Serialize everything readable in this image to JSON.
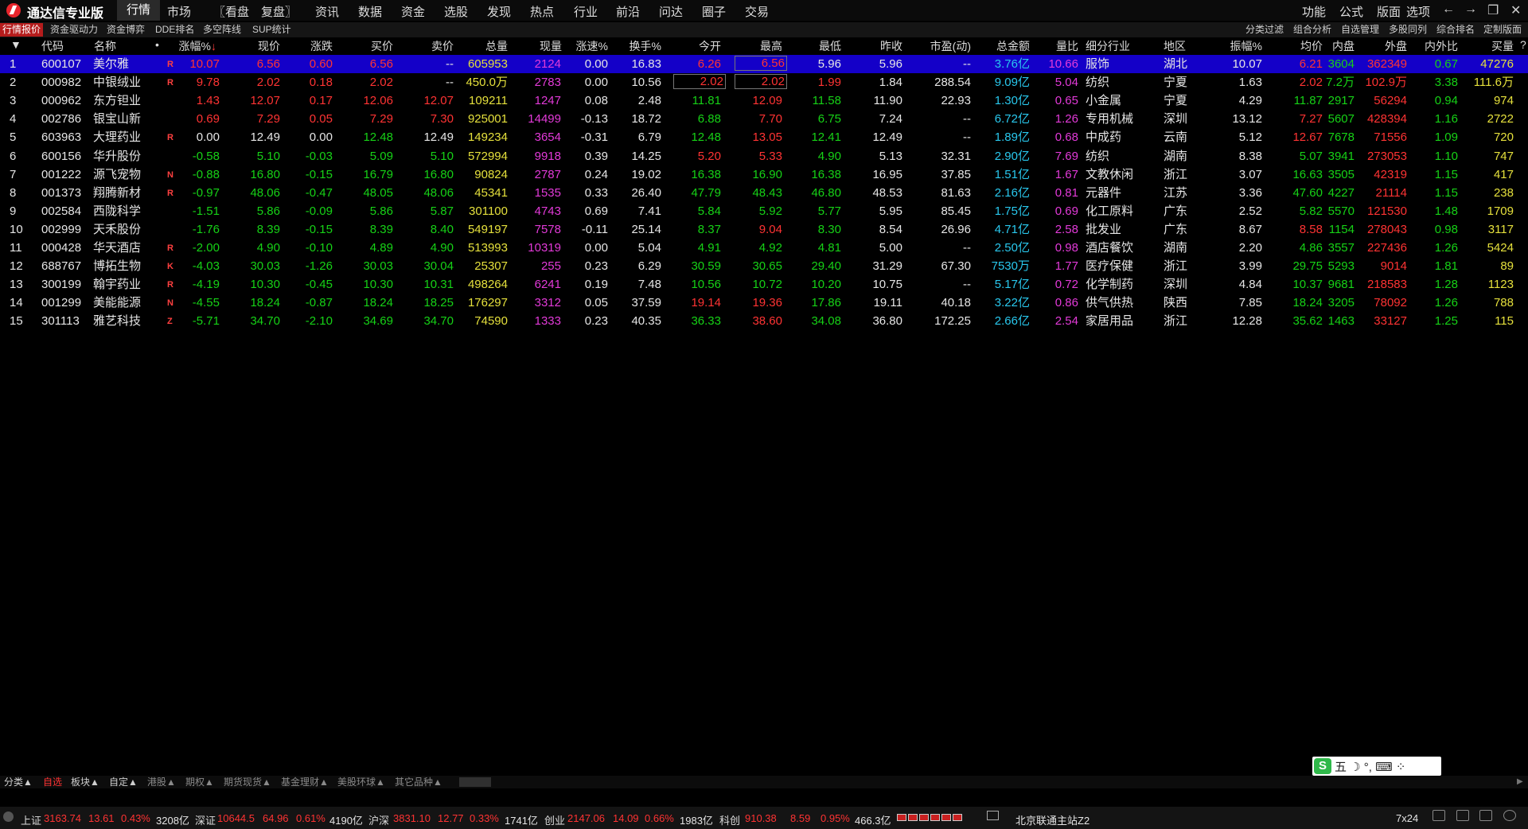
{
  "app": {
    "title": "通达信专业版"
  },
  "menu": [
    "行情",
    "市场",
    "〖看盘",
    "复盘〗",
    "资讯",
    "数据",
    "资金",
    "选股",
    "发现",
    "热点",
    "行业",
    "前沿",
    "问达",
    "圈子",
    "交易"
  ],
  "right_menu": [
    "功能",
    "公式",
    "版面",
    "选项"
  ],
  "window_controls": {
    "back": "←",
    "forward": "→",
    "restore": "❐",
    "minimize": "—",
    "close": "✕"
  },
  "tabs": [
    "行情报价",
    "资金驱动力",
    "资金博弈",
    "DDE排名",
    "多空阵线",
    "SUP统计"
  ],
  "right_tabs": [
    "分类过滤",
    "组合分析",
    "自选管理",
    "多股同列",
    "综合排名",
    "定制版面"
  ],
  "table": {
    "headers": {
      "idx": "▼",
      "code": "代码",
      "name": "名称",
      "dot": "•",
      "pct": "涨幅%",
      "sort": "↓",
      "price": "现价",
      "chg": "涨跌",
      "bid": "买价",
      "ask": "卖价",
      "vol": "总量",
      "cur": "现量",
      "speed": "涨速%",
      "turn": "换手%",
      "open": "今开",
      "high": "最高",
      "low": "最低",
      "prev": "昨收",
      "pe": "市盈(动)",
      "amount": "总金额",
      "vratio": "量比",
      "industry": "细分行业",
      "region": "地区",
      "amp": "振幅%",
      "avg": "均价",
      "inner": "内盘",
      "outer": "外盘",
      "io": "内外比",
      "bidvol": "买量",
      "q": "?"
    },
    "rows": [
      {
        "n": "1",
        "code": "600107",
        "name": "美尔雅",
        "tag": "R",
        "pct": "10.07",
        "price": "6.56",
        "chg": "0.60",
        "bid": "6.56",
        "ask": "--",
        "vol": "605953",
        "cur": "2124",
        "speed": "0.00",
        "turn": "16.83",
        "open": "6.26",
        "high": "6.56",
        "low": "5.96",
        "prev": "5.96",
        "pe": "--",
        "amount": "3.76亿",
        "vratio": "10.66",
        "industry": "服饰",
        "region": "湖北",
        "amp": "10.07",
        "avg": "6.21",
        "inner": "3604",
        "outer": "362349",
        "io": "0.67",
        "bidvol": "47276",
        "c": {
          "pct": "red",
          "price": "red",
          "chg": "red",
          "bid": "red",
          "ask": "white",
          "open": "red",
          "high": "red",
          "low": "white",
          "avg": "red"
        }
      },
      {
        "n": "2",
        "code": "000982",
        "name": "中银绒业",
        "tag": "R",
        "pct": "9.78",
        "price": "2.02",
        "chg": "0.18",
        "bid": "2.02",
        "ask": "--",
        "vol": "450.0万",
        "cur": "2783",
        "speed": "0.00",
        "turn": "10.56",
        "open": "2.02",
        "high": "2.02",
        "low": "1.99",
        "prev": "1.84",
        "pe": "288.54",
        "amount": "9.09亿",
        "vratio": "5.04",
        "industry": "纺织",
        "region": "宁夏",
        "amp": "1.63",
        "avg": "2.02",
        "inner": "7.2万",
        "outer": "102.9万",
        "io": "3.38",
        "bidvol": "111.6万",
        "c": {
          "pct": "red",
          "price": "red",
          "chg": "red",
          "bid": "red",
          "ask": "white",
          "open": "red",
          "high": "red",
          "low": "red",
          "avg": "red"
        }
      },
      {
        "n": "3",
        "code": "000962",
        "name": "东方钽业",
        "tag": "",
        "pct": "1.43",
        "price": "12.07",
        "chg": "0.17",
        "bid": "12.06",
        "ask": "12.07",
        "vol": "109211",
        "cur": "1247",
        "speed": "0.08",
        "turn": "2.48",
        "open": "11.81",
        "high": "12.09",
        "low": "11.58",
        "prev": "11.90",
        "pe": "22.93",
        "amount": "1.30亿",
        "vratio": "0.65",
        "industry": "小金属",
        "region": "宁夏",
        "amp": "4.29",
        "avg": "11.87",
        "inner": "2917",
        "outer": "56294",
        "io": "0.94",
        "bidvol": "974",
        "c": {
          "pct": "red",
          "price": "red",
          "chg": "red",
          "bid": "red",
          "ask": "red",
          "open": "green",
          "high": "red",
          "low": "green",
          "avg": "green"
        }
      },
      {
        "n": "4",
        "code": "002786",
        "name": "银宝山新",
        "tag": "",
        "pct": "0.69",
        "price": "7.29",
        "chg": "0.05",
        "bid": "7.29",
        "ask": "7.30",
        "vol": "925001",
        "cur": "14499",
        "speed": "-0.13",
        "turn": "18.72",
        "open": "6.88",
        "high": "7.70",
        "low": "6.75",
        "prev": "7.24",
        "pe": "--",
        "amount": "6.72亿",
        "vratio": "1.26",
        "industry": "专用机械",
        "region": "深圳",
        "amp": "13.12",
        "avg": "7.27",
        "inner": "5607",
        "outer": "428394",
        "io": "1.16",
        "bidvol": "2722",
        "c": {
          "pct": "red",
          "price": "red",
          "chg": "red",
          "bid": "red",
          "ask": "red",
          "open": "green",
          "high": "red",
          "low": "green",
          "avg": "red"
        }
      },
      {
        "n": "5",
        "code": "603963",
        "name": "大理药业",
        "tag": "R",
        "pct": "0.00",
        "price": "12.49",
        "chg": "0.00",
        "bid": "12.48",
        "ask": "12.49",
        "vol": "149234",
        "cur": "3654",
        "speed": "-0.31",
        "turn": "6.79",
        "open": "12.48",
        "high": "13.05",
        "low": "12.41",
        "prev": "12.49",
        "pe": "--",
        "amount": "1.89亿",
        "vratio": "0.68",
        "industry": "中成药",
        "region": "云南",
        "amp": "5.12",
        "avg": "12.67",
        "inner": "7678",
        "outer": "71556",
        "io": "1.09",
        "bidvol": "720",
        "c": {
          "pct": "white",
          "price": "white",
          "chg": "white",
          "bid": "green",
          "ask": "white",
          "open": "green",
          "high": "red",
          "low": "green",
          "avg": "red"
        }
      },
      {
        "n": "6",
        "code": "600156",
        "name": "华升股份",
        "tag": "",
        "pct": "-0.58",
        "price": "5.10",
        "chg": "-0.03",
        "bid": "5.09",
        "ask": "5.10",
        "vol": "572994",
        "cur": "9918",
        "speed": "0.39",
        "turn": "14.25",
        "open": "5.20",
        "high": "5.33",
        "low": "4.90",
        "prev": "5.13",
        "pe": "32.31",
        "amount": "2.90亿",
        "vratio": "7.69",
        "industry": "纺织",
        "region": "湖南",
        "amp": "8.38",
        "avg": "5.07",
        "inner": "3941",
        "outer": "273053",
        "io": "1.10",
        "bidvol": "747",
        "c": {
          "pct": "green",
          "price": "green",
          "chg": "green",
          "bid": "green",
          "ask": "green",
          "open": "red",
          "high": "red",
          "low": "green",
          "avg": "green"
        }
      },
      {
        "n": "7",
        "code": "001222",
        "name": "源飞宠物",
        "tag": "N",
        "pct": "-0.88",
        "price": "16.80",
        "chg": "-0.15",
        "bid": "16.79",
        "ask": "16.80",
        "vol": "90824",
        "cur": "2787",
        "speed": "0.24",
        "turn": "19.02",
        "open": "16.38",
        "high": "16.90",
        "low": "16.38",
        "prev": "16.95",
        "pe": "37.85",
        "amount": "1.51亿",
        "vratio": "1.67",
        "industry": "文教休闲",
        "region": "浙江",
        "amp": "3.07",
        "avg": "16.63",
        "inner": "3505",
        "outer": "42319",
        "io": "1.15",
        "bidvol": "417",
        "c": {
          "pct": "green",
          "price": "green",
          "chg": "green",
          "bid": "green",
          "ask": "green",
          "open": "green",
          "high": "green",
          "low": "green",
          "avg": "green"
        }
      },
      {
        "n": "8",
        "code": "001373",
        "name": "翔腾新材",
        "tag": "R",
        "pct": "-0.97",
        "price": "48.06",
        "chg": "-0.47",
        "bid": "48.05",
        "ask": "48.06",
        "vol": "45341",
        "cur": "1535",
        "speed": "0.33",
        "turn": "26.40",
        "open": "47.79",
        "high": "48.43",
        "low": "46.80",
        "prev": "48.53",
        "pe": "81.63",
        "amount": "2.16亿",
        "vratio": "0.81",
        "industry": "元器件",
        "region": "江苏",
        "amp": "3.36",
        "avg": "47.60",
        "inner": "4227",
        "outer": "21114",
        "io": "1.15",
        "bidvol": "238",
        "c": {
          "pct": "green",
          "price": "green",
          "chg": "green",
          "bid": "green",
          "ask": "green",
          "open": "green",
          "high": "green",
          "low": "green",
          "avg": "green"
        }
      },
      {
        "n": "9",
        "code": "002584",
        "name": "西陇科学",
        "tag": "",
        "pct": "-1.51",
        "price": "5.86",
        "chg": "-0.09",
        "bid": "5.86",
        "ask": "5.87",
        "vol": "301100",
        "cur": "4743",
        "speed": "0.69",
        "turn": "7.41",
        "open": "5.84",
        "high": "5.92",
        "low": "5.77",
        "prev": "5.95",
        "pe": "85.45",
        "amount": "1.75亿",
        "vratio": "0.69",
        "industry": "化工原料",
        "region": "广东",
        "amp": "2.52",
        "avg": "5.82",
        "inner": "5570",
        "outer": "121530",
        "io": "1.48",
        "bidvol": "1709",
        "c": {
          "pct": "green",
          "price": "green",
          "chg": "green",
          "bid": "green",
          "ask": "green",
          "open": "green",
          "high": "green",
          "low": "green",
          "avg": "green"
        }
      },
      {
        "n": "10",
        "code": "002999",
        "name": "天禾股份",
        "tag": "",
        "pct": "-1.76",
        "price": "8.39",
        "chg": "-0.15",
        "bid": "8.39",
        "ask": "8.40",
        "vol": "549197",
        "cur": "7578",
        "speed": "-0.11",
        "turn": "25.14",
        "open": "8.37",
        "high": "9.04",
        "low": "8.30",
        "prev": "8.54",
        "pe": "26.96",
        "amount": "4.71亿",
        "vratio": "2.58",
        "industry": "批发业",
        "region": "广东",
        "amp": "8.67",
        "avg": "8.58",
        "inner": "1154",
        "outer": "278043",
        "io": "0.98",
        "bidvol": "3117",
        "c": {
          "pct": "green",
          "price": "green",
          "chg": "green",
          "bid": "green",
          "ask": "green",
          "open": "green",
          "high": "red",
          "low": "green",
          "avg": "red"
        }
      },
      {
        "n": "11",
        "code": "000428",
        "name": "华天酒店",
        "tag": "R",
        "pct": "-2.00",
        "price": "4.90",
        "chg": "-0.10",
        "bid": "4.89",
        "ask": "4.90",
        "vol": "513993",
        "cur": "10319",
        "speed": "0.00",
        "turn": "5.04",
        "open": "4.91",
        "high": "4.92",
        "low": "4.81",
        "prev": "5.00",
        "pe": "--",
        "amount": "2.50亿",
        "vratio": "0.98",
        "industry": "酒店餐饮",
        "region": "湖南",
        "amp": "2.20",
        "avg": "4.86",
        "inner": "3557",
        "outer": "227436",
        "io": "1.26",
        "bidvol": "5424",
        "c": {
          "pct": "green",
          "price": "green",
          "chg": "green",
          "bid": "green",
          "ask": "green",
          "open": "green",
          "high": "green",
          "low": "green",
          "avg": "green"
        }
      },
      {
        "n": "12",
        "code": "688767",
        "name": "博拓生物",
        "tag": "K",
        "pct": "-4.03",
        "price": "30.03",
        "chg": "-1.26",
        "bid": "30.03",
        "ask": "30.04",
        "vol": "25307",
        "cur": "255",
        "speed": "0.23",
        "turn": "6.29",
        "open": "30.59",
        "high": "30.65",
        "low": "29.40",
        "prev": "31.29",
        "pe": "67.30",
        "amount": "7530万",
        "vratio": "1.77",
        "industry": "医疗保健",
        "region": "浙江",
        "amp": "3.99",
        "avg": "29.75",
        "inner": "5293",
        "outer": "9014",
        "io": "1.81",
        "bidvol": "89",
        "c": {
          "pct": "green",
          "price": "green",
          "chg": "green",
          "bid": "green",
          "ask": "green",
          "open": "green",
          "high": "green",
          "low": "green",
          "avg": "green"
        }
      },
      {
        "n": "13",
        "code": "300199",
        "name": "翰宇药业",
        "tag": "R",
        "pct": "-4.19",
        "price": "10.30",
        "chg": "-0.45",
        "bid": "10.30",
        "ask": "10.31",
        "vol": "498264",
        "cur": "6241",
        "speed": "0.19",
        "turn": "7.48",
        "open": "10.56",
        "high": "10.72",
        "low": "10.20",
        "prev": "10.75",
        "pe": "--",
        "amount": "5.17亿",
        "vratio": "0.72",
        "industry": "化学制药",
        "region": "深圳",
        "amp": "4.84",
        "avg": "10.37",
        "inner": "9681",
        "outer": "218583",
        "io": "1.28",
        "bidvol": "1123",
        "c": {
          "pct": "green",
          "price": "green",
          "chg": "green",
          "bid": "green",
          "ask": "green",
          "open": "green",
          "high": "green",
          "low": "green",
          "avg": "green"
        }
      },
      {
        "n": "14",
        "code": "001299",
        "name": "美能能源",
        "tag": "N",
        "pct": "-4.55",
        "price": "18.24",
        "chg": "-0.87",
        "bid": "18.24",
        "ask": "18.25",
        "vol": "176297",
        "cur": "3312",
        "speed": "0.05",
        "turn": "37.59",
        "open": "19.14",
        "high": "19.36",
        "low": "17.86",
        "prev": "19.11",
        "pe": "40.18",
        "amount": "3.22亿",
        "vratio": "0.86",
        "industry": "供气供热",
        "region": "陕西",
        "amp": "7.85",
        "avg": "18.24",
        "inner": "3205",
        "outer": "78092",
        "io": "1.26",
        "bidvol": "788",
        "c": {
          "pct": "green",
          "price": "green",
          "chg": "green",
          "bid": "green",
          "ask": "green",
          "open": "red",
          "high": "red",
          "low": "green",
          "avg": "green"
        }
      },
      {
        "n": "15",
        "code": "301113",
        "name": "雅艺科技",
        "tag": "Z",
        "pct": "-5.71",
        "price": "34.70",
        "chg": "-2.10",
        "bid": "34.69",
        "ask": "34.70",
        "vol": "74590",
        "cur": "1333",
        "speed": "0.23",
        "turn": "40.35",
        "open": "36.33",
        "high": "38.60",
        "low": "34.08",
        "prev": "36.80",
        "pe": "172.25",
        "amount": "2.66亿",
        "vratio": "2.54",
        "industry": "家居用品",
        "region": "浙江",
        "amp": "12.28",
        "avg": "35.62",
        "inner": "1463",
        "outer": "33127",
        "io": "1.25",
        "bidvol": "115",
        "c": {
          "pct": "green",
          "price": "green",
          "chg": "green",
          "bid": "green",
          "ask": "green",
          "open": "green",
          "high": "red",
          "low": "green",
          "avg": "green"
        }
      }
    ]
  },
  "categories": [
    "分类▲",
    "自选",
    "板块▲",
    "自定▲",
    "港股▲",
    "期权▲",
    "期货现货▲",
    "基金理财▲",
    "美股环球▲",
    "其它品种▲"
  ],
  "ime": {
    "text": "五 ☽ °, ⌨ ⁘"
  },
  "status": {
    "sh": {
      "label": "上证",
      "value": "3163.74",
      "chg": "13.61",
      "pct": "0.43%",
      "amount": "3208亿"
    },
    "sz": {
      "label": "深证",
      "value": "10644.5",
      "chg": "64.96",
      "pct": "0.61%",
      "amount": "4190亿"
    },
    "hs": {
      "label": "沪深",
      "value": "3831.10",
      "chg": "12.77",
      "pct": "0.33%",
      "amount": "1741亿"
    },
    "cy": {
      "label": "创业",
      "value": "2147.06",
      "chg": "14.09",
      "pct": "0.66%",
      "amount": "1983亿"
    },
    "kc": {
      "label": "科创",
      "value": "910.38",
      "chg": "8.59",
      "pct": "0.95%",
      "amount": "466.3亿"
    },
    "server": "北京联通主站Z2",
    "session": "7x24"
  }
}
